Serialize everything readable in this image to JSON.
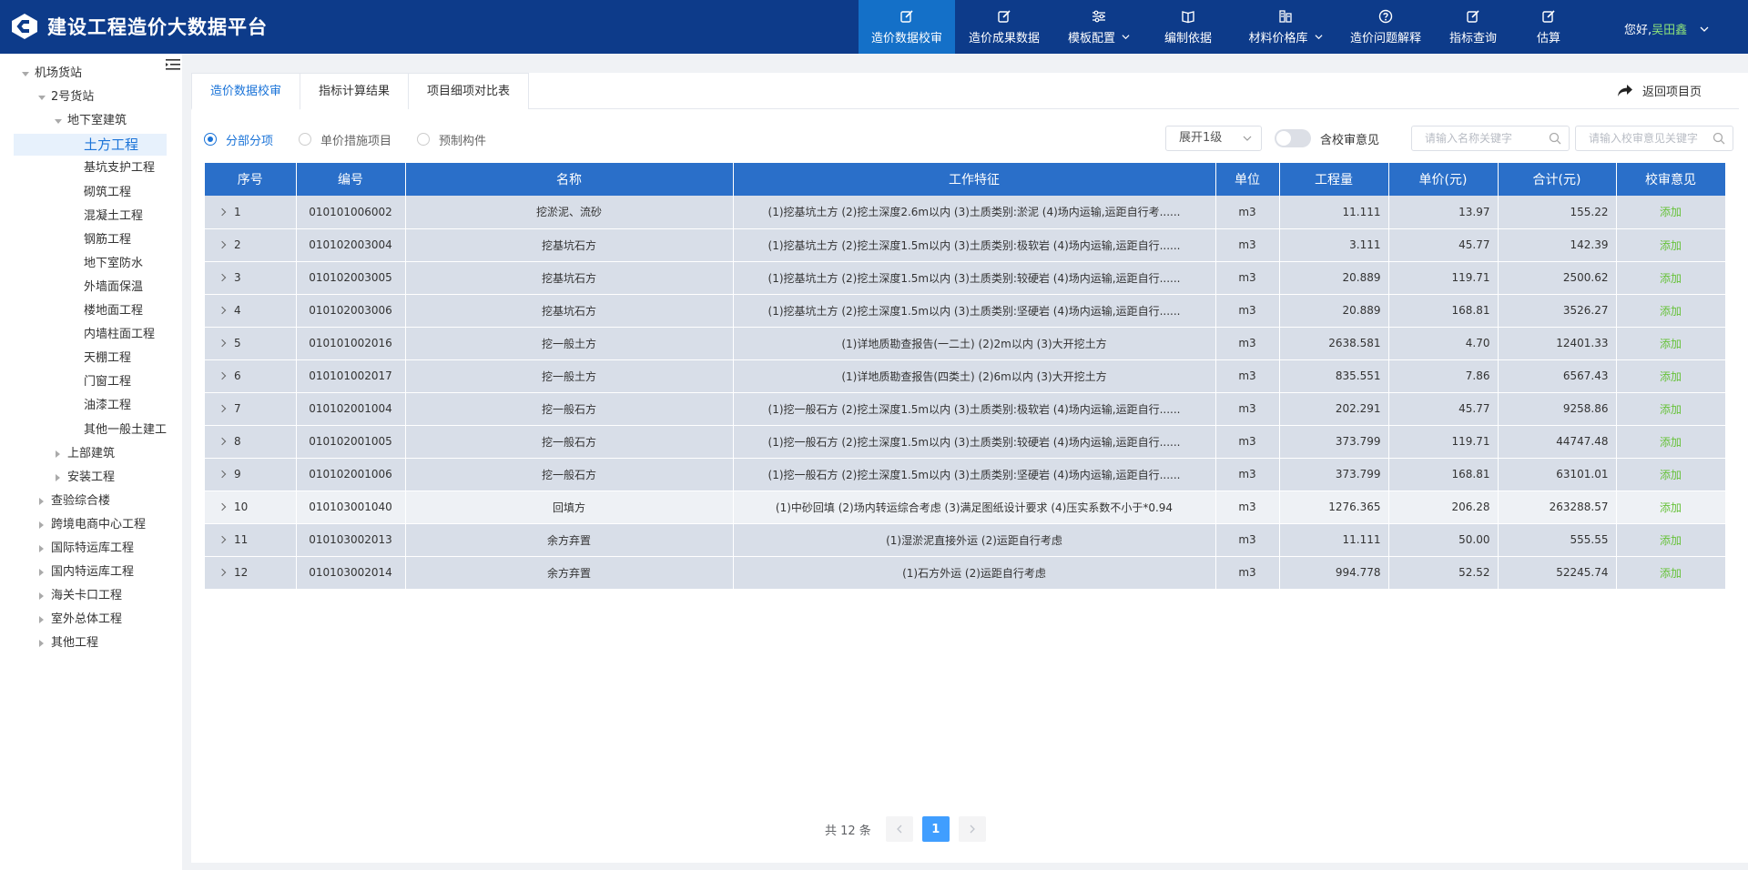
{
  "app": {
    "title": "建设工程造价大数据平台"
  },
  "nav": [
    {
      "label": "造价数据校审",
      "icon": "edit-icon",
      "active": true,
      "dropdown": false
    },
    {
      "label": "造价成果数据",
      "icon": "edit-icon",
      "active": false,
      "dropdown": false
    },
    {
      "label": "模板配置",
      "icon": "sliders-icon",
      "active": false,
      "dropdown": true
    },
    {
      "label": "编制依据",
      "icon": "book-icon",
      "active": false,
      "dropdown": false
    },
    {
      "label": "材料价格库",
      "icon": "database-icon",
      "active": false,
      "dropdown": true
    },
    {
      "label": "造价问题解释",
      "icon": "question-icon",
      "active": false,
      "dropdown": false
    },
    {
      "label": "指标查询",
      "icon": "edit-icon",
      "active": false,
      "dropdown": false
    },
    {
      "label": "估算",
      "icon": "edit-icon",
      "active": false,
      "dropdown": false
    }
  ],
  "user": {
    "greeting": "您好,",
    "name": "吴田鑫"
  },
  "tree": [
    {
      "label": "机场货站",
      "level": 0,
      "state": "open"
    },
    {
      "label": "2号货站",
      "level": 1,
      "state": "open"
    },
    {
      "label": "地下室建筑",
      "level": 2,
      "state": "open"
    },
    {
      "label": "土方工程",
      "level": 3,
      "state": "leaf",
      "selected": true
    },
    {
      "label": "基坑支护工程",
      "level": 3,
      "state": "leaf"
    },
    {
      "label": "砌筑工程",
      "level": 3,
      "state": "leaf"
    },
    {
      "label": "混凝土工程",
      "level": 3,
      "state": "leaf"
    },
    {
      "label": "钢筋工程",
      "level": 3,
      "state": "leaf"
    },
    {
      "label": "地下室防水",
      "level": 3,
      "state": "leaf"
    },
    {
      "label": "外墙面保温",
      "level": 3,
      "state": "leaf"
    },
    {
      "label": "楼地面工程",
      "level": 3,
      "state": "leaf"
    },
    {
      "label": "内墙柱面工程",
      "level": 3,
      "state": "leaf"
    },
    {
      "label": "天棚工程",
      "level": 3,
      "state": "leaf"
    },
    {
      "label": "门窗工程",
      "level": 3,
      "state": "leaf"
    },
    {
      "label": "油漆工程",
      "level": 3,
      "state": "leaf"
    },
    {
      "label": "其他一般土建工",
      "level": 3,
      "state": "leaf"
    },
    {
      "label": "上部建筑",
      "level": 2,
      "state": "closed"
    },
    {
      "label": "安装工程",
      "level": 2,
      "state": "closed"
    },
    {
      "label": "查验综合楼",
      "level": 1,
      "state": "closed"
    },
    {
      "label": "跨境电商中心工程",
      "level": 1,
      "state": "closed"
    },
    {
      "label": "国际特运库工程",
      "level": 1,
      "state": "closed"
    },
    {
      "label": "国内特运库工程",
      "level": 1,
      "state": "closed"
    },
    {
      "label": "海关卡口工程",
      "level": 1,
      "state": "closed"
    },
    {
      "label": "室外总体工程",
      "level": 1,
      "state": "closed"
    },
    {
      "label": "其他工程",
      "level": 1,
      "state": "closed"
    }
  ],
  "tabs": [
    {
      "label": "造价数据校审",
      "active": true
    },
    {
      "label": "指标计算结果",
      "active": false
    },
    {
      "label": "项目细项对比表",
      "active": false
    }
  ],
  "back_label": "返回项目页",
  "radios": [
    {
      "label": "分部分项",
      "checked": true
    },
    {
      "label": "单价措施项目",
      "checked": false
    },
    {
      "label": "预制构件",
      "checked": false
    }
  ],
  "expand_select": "展开1级",
  "switch_label": "含校审意见",
  "search_name_placeholder": "请输入名称关键字",
  "search_opinion_placeholder": "请输入校审意见关键字",
  "table": {
    "headers": [
      "序号",
      "编号",
      "名称",
      "工作特征",
      "单位",
      "工程量",
      "单价(元)",
      "合计(元)",
      "校审意见"
    ],
    "rows": [
      [
        "1",
        "010101006002",
        "挖淤泥、流砂",
        "(1)挖基坑土方 (2)挖土深度2.6m以内 (3)土质类别:淤泥 (4)场内运输,运距自行考......",
        "m3",
        "11.111",
        "13.97",
        "155.22",
        "添加"
      ],
      [
        "2",
        "010102003004",
        "挖基坑石方",
        "(1)挖基坑土方 (2)挖土深度1.5m以内 (3)土质类别:极软岩 (4)场内运输,运距自行......",
        "m3",
        "3.111",
        "45.77",
        "142.39",
        "添加"
      ],
      [
        "3",
        "010102003005",
        "挖基坑石方",
        "(1)挖基坑土方 (2)挖土深度1.5m以内 (3)土质类别:较硬岩 (4)场内运输,运距自行......",
        "m3",
        "20.889",
        "119.71",
        "2500.62",
        "添加"
      ],
      [
        "4",
        "010102003006",
        "挖基坑石方",
        "(1)挖基坑土方 (2)挖土深度1.5m以内 (3)土质类别:坚硬岩 (4)场内运输,运距自行......",
        "m3",
        "20.889",
        "168.81",
        "3526.27",
        "添加"
      ],
      [
        "5",
        "010101002016",
        "挖一般土方",
        "(1)详地质勘查报告(一二土) (2)2m以内 (3)大开挖土方",
        "m3",
        "2638.581",
        "4.70",
        "12401.33",
        "添加"
      ],
      [
        "6",
        "010101002017",
        "挖一般土方",
        "(1)详地质勘查报告(四类土) (2)6m以内 (3)大开挖土方",
        "m3",
        "835.551",
        "7.86",
        "6567.43",
        "添加"
      ],
      [
        "7",
        "010102001004",
        "挖一般石方",
        "(1)挖一般石方 (2)挖土深度1.5m以内 (3)土质类别:极软岩 (4)场内运输,运距自行......",
        "m3",
        "202.291",
        "45.77",
        "9258.86",
        "添加"
      ],
      [
        "8",
        "010102001005",
        "挖一般石方",
        "(1)挖一般石方 (2)挖土深度1.5m以内 (3)土质类别:较硬岩 (4)场内运输,运距自行......",
        "m3",
        "373.799",
        "119.71",
        "44747.48",
        "添加"
      ],
      [
        "9",
        "010102001006",
        "挖一般石方",
        "(1)挖一般石方 (2)挖土深度1.5m以内 (3)土质类别:坚硬岩 (4)场内运输,运距自行......",
        "m3",
        "373.799",
        "168.81",
        "63101.01",
        "添加"
      ],
      [
        "10",
        "010103001040",
        "回填方",
        "(1)中砂回填 (2)场内转运综合考虑 (3)满足图纸设计要求 (4)压实系数不小于*0.94",
        "m3",
        "1276.365",
        "206.28",
        "263288.57",
        "添加"
      ],
      [
        "11",
        "010103002013",
        "余方弃置",
        "(1)湿淤泥直接外运 (2)运距自行考虑",
        "m3",
        "11.111",
        "50.00",
        "555.55",
        "添加"
      ],
      [
        "12",
        "010103002014",
        "余方弃置",
        "(1)石方外运 (2)运距自行考虑",
        "m3",
        "994.778",
        "52.52",
        "52245.74",
        "添加"
      ]
    ],
    "highlight_row": 9
  },
  "pager": {
    "total": "共 12 条",
    "current": "1"
  },
  "colors": {
    "header_bg": "#0d3b8a",
    "nav_active": "#1470c8",
    "table_header": "#2a6fc9",
    "accent": "#1a73d8",
    "action": "#67c23a"
  }
}
